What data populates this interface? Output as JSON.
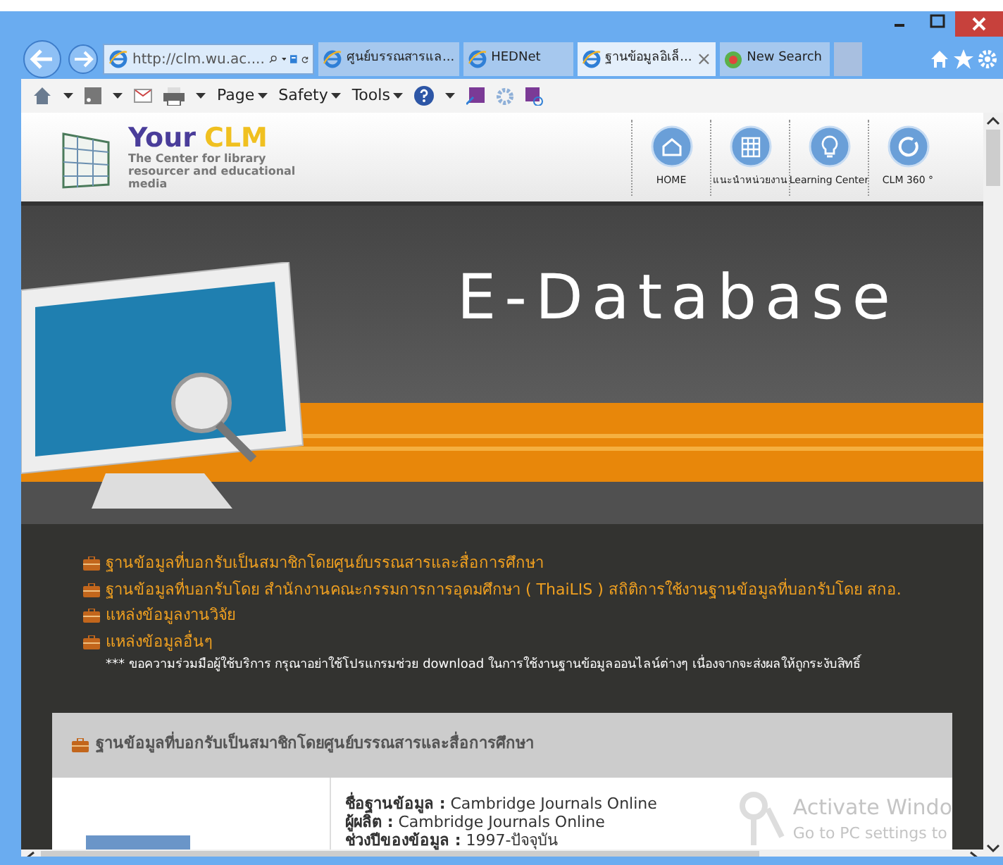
{
  "browser": {
    "address": "http://clm.wu.ac....",
    "tabs": [
      {
        "label": "ศูนย์บรรณสารแล...",
        "selected": false,
        "kind": "ie"
      },
      {
        "label": "HEDNet",
        "selected": false,
        "kind": "ie"
      },
      {
        "label": "ฐานข้อมูลอิเล็...",
        "selected": true,
        "kind": "ie"
      },
      {
        "label": "New Search",
        "selected": false,
        "kind": "search"
      }
    ],
    "close_glyph": "×",
    "commands": [
      {
        "label": "Page"
      },
      {
        "label": "Safety"
      },
      {
        "label": "Tools"
      }
    ]
  },
  "site": {
    "logo_your": "Your",
    "logo_clm": "CLM",
    "logo_tagline": "The Center for library resourcer and educational media",
    "nav": [
      {
        "label": "HOME",
        "kind": "home"
      },
      {
        "label": "แนะนำหน่วยงาน",
        "kind": "building"
      },
      {
        "label": "Learning Center",
        "kind": "bulb"
      },
      {
        "label": "CLM 360 °",
        "kind": "cycle"
      }
    ],
    "banner_title": "E-Database",
    "links": [
      "ฐานข้อมูลที่บอกรับเป็นสมาชิกโดยศูนย์บรรณสารและสื่อการศึกษา",
      "ฐานข้อมูลที่บอกรับโดย สำนักงานคณะกรรมการการอุดมศึกษา ( ThaiLIS ) สถิติการใช้งานฐานข้อมูลที่บอกรับโดย สกอ.",
      "แหล่งข้อมูลงานวิจัย",
      "แหล่งข้อมูลอื่นๆ"
    ],
    "notice": "*** ขอความร่วมมือผู้ใช้บริการ กรุณาอย่าใช้โปรแกรมช่วย download ในการใช้งานฐานข้อมูลออนไลน์ต่างๆ เนื่องจากจะส่งผลให้ถูกระงับสิทธิ์",
    "section_title": "ฐานข้อมูลที่บอกรับเป็นสมาชิกโดยศูนย์บรรณสารและสื่อการศึกษา",
    "details": [
      "**ชื่อฐานข้อมูล :** Cambridge Journals Online",
      "**ผู้ผลิต :** Cambridge Journals Online",
      "**ช่วงปีของข้อมูล :** 1997-ปัจจุบัน"
    ]
  },
  "watermark": {
    "title": "Activate Windo",
    "subtitle": "Go to PC settings to"
  }
}
